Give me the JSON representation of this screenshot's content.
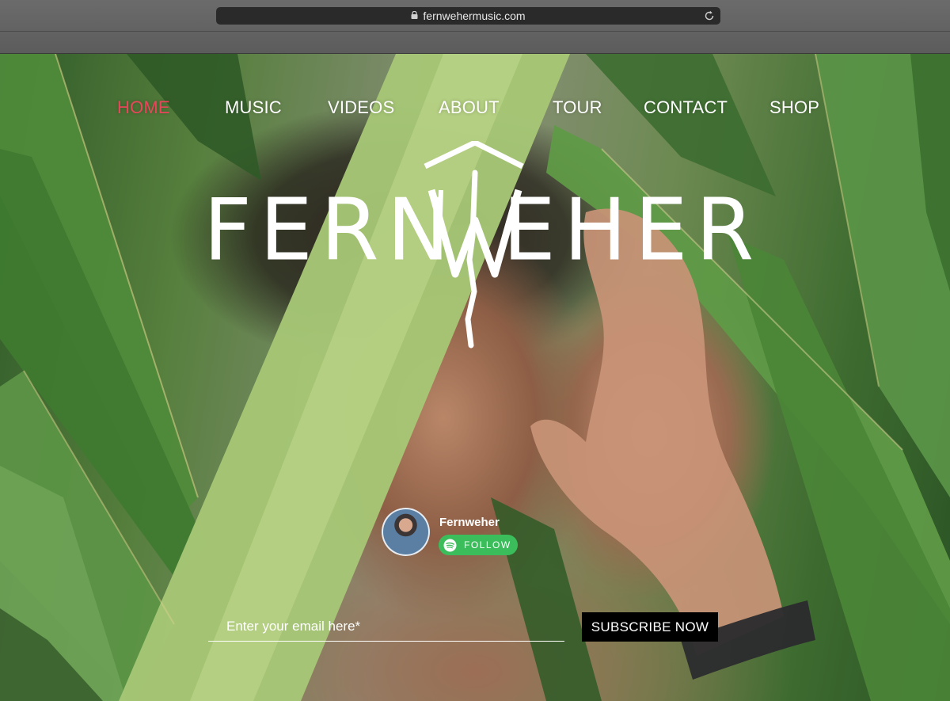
{
  "browser": {
    "url": "fernwehermusic.com",
    "lock_icon": "lock-icon",
    "reload_icon": "reload-icon"
  },
  "nav": {
    "items": [
      {
        "label": "HOME",
        "active": true
      },
      {
        "label": "MUSIC",
        "active": false
      },
      {
        "label": "VIDEOS",
        "active": false
      },
      {
        "label": "ABOUT",
        "active": false
      },
      {
        "label": "TOUR",
        "active": false
      },
      {
        "label": "CONTACT",
        "active": false
      },
      {
        "label": "SHOP",
        "active": false
      }
    ],
    "active_color": "#e8465a",
    "text_color": "#ffffff"
  },
  "logo": {
    "text_left": "FERN",
    "text_right": "EHER",
    "full_name": "FERNWEHER"
  },
  "spotify": {
    "artist_name": "Fernweher",
    "follow_label": "FOLLOW",
    "icon": "spotify-icon",
    "button_color": "#3cbd5b"
  },
  "subscribe": {
    "email_placeholder": "Enter your email here*",
    "button_label": "SUBSCRIBE NOW"
  }
}
